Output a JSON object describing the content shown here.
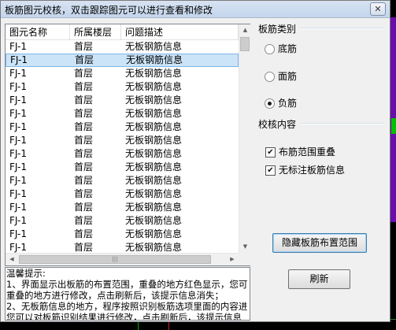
{
  "window": {
    "title": "板筋图元校核，双击跟踪图元可以进行查看和修改",
    "close_glyph": "✕"
  },
  "list": {
    "columns": [
      "图元名称",
      "所属楼层",
      "问题描述"
    ],
    "rows": [
      [
        "FJ-1",
        "首层",
        "无板钢筋信息"
      ],
      [
        "FJ-1",
        "首层",
        "无板钢筋信息"
      ],
      [
        "FJ-1",
        "首层",
        "无板钢筋信息"
      ],
      [
        "FJ-1",
        "首层",
        "无板钢筋信息"
      ],
      [
        "FJ-1",
        "首层",
        "无板钢筋信息"
      ],
      [
        "FJ-1",
        "首层",
        "无板钢筋信息"
      ],
      [
        "FJ-1",
        "首层",
        "无板钢筋信息"
      ],
      [
        "FJ-1",
        "首层",
        "无板钢筋信息"
      ],
      [
        "FJ-1",
        "首层",
        "无板钢筋信息"
      ],
      [
        "FJ-1",
        "首层",
        "无板钢筋信息"
      ],
      [
        "FJ-1",
        "首层",
        "无板钢筋信息"
      ],
      [
        "FJ-1",
        "首层",
        "无板钢筋信息"
      ],
      [
        "FJ-1",
        "首层",
        "无板钢筋信息"
      ],
      [
        "FJ-1",
        "首层",
        "无板钢筋信息"
      ],
      [
        "FJ-1",
        "首层",
        "无板钢筋信息"
      ],
      [
        "FJ-1",
        "首层",
        "无板钢筋信息"
      ]
    ],
    "selected_row": 1
  },
  "tips": {
    "lines": [
      "温馨提示:",
      "1、界面显示出板筋的布置范围，重叠的地方红色显示，您可",
      "重叠的地方进行修改，点击刷新后，该提示信息消失；",
      "2、无板筋信息的地方，程序按照识别板筋选项里面的内容进",
      "您可以对板筋识别结果进行修改，点击刷新后，该提示信息"
    ]
  },
  "rebar_type": {
    "label": "板筋类别",
    "options": [
      "底筋",
      "面筋",
      "负筋"
    ],
    "selected": 2
  },
  "check_content": {
    "label": "校核内容",
    "options": [
      "布筋范围重叠",
      "无标注板筋信息"
    ],
    "checked": [
      true,
      true
    ],
    "check_glyph": "✔"
  },
  "buttons": {
    "hide_range": "隐藏板筋布置范围",
    "refresh": "刷新"
  }
}
